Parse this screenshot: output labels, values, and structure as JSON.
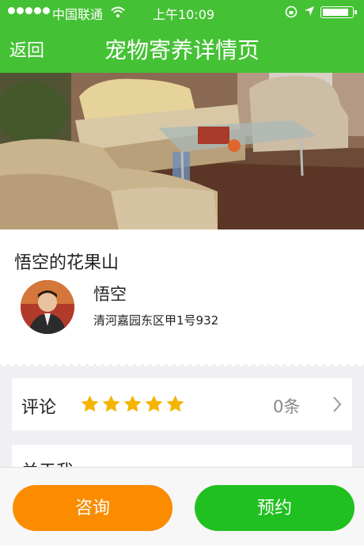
{
  "status_bar": {
    "carrier": "中国联通",
    "time": "上午10:09"
  },
  "header": {
    "back_label": "返回",
    "title": "宠物寄养详情页"
  },
  "host": {
    "name": "悟空的花果山",
    "user_name": "悟空",
    "address": "清河嘉园东区甲1号932"
  },
  "reviews": {
    "label": "评论",
    "rating": 5,
    "count_text": "0条"
  },
  "about": {
    "label": "关于我"
  },
  "actions": {
    "consult_label": "咨询",
    "book_label": "预约"
  },
  "colors": {
    "brand_green": "#45c135",
    "consult_orange": "#fb8c00",
    "book_green": "#20c020",
    "star_gold": "#f5b400"
  }
}
